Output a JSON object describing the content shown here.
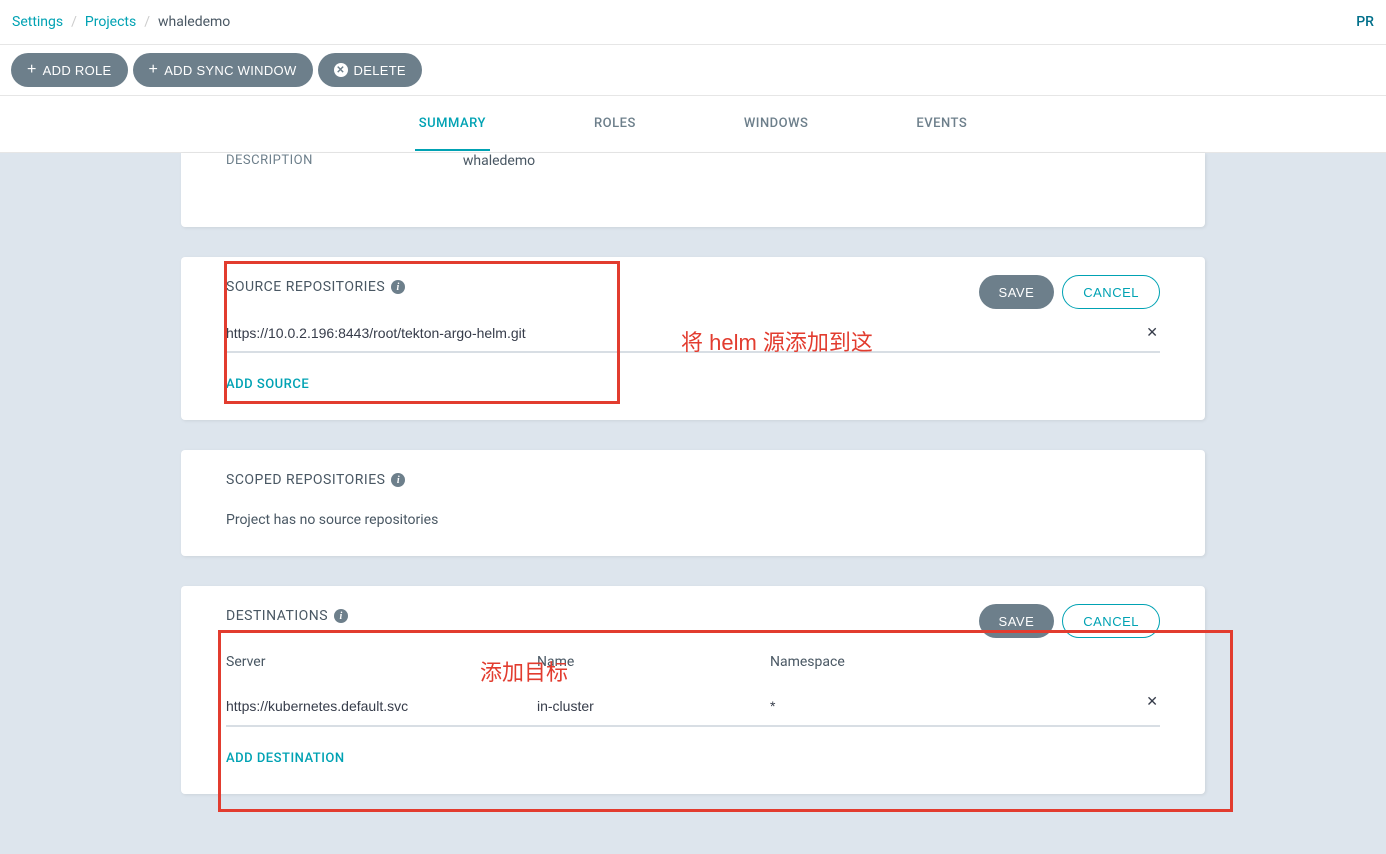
{
  "breadcrumb": {
    "settings": "Settings",
    "projects": "Projects",
    "current": "whaledemo"
  },
  "user_badge": "PR",
  "toolbar": {
    "add_role": "ADD ROLE",
    "add_sync_window": "ADD SYNC WINDOW",
    "delete": "DELETE"
  },
  "tabs": {
    "summary": "SUMMARY",
    "roles": "ROLES",
    "windows": "WINDOWS",
    "events": "EVENTS"
  },
  "description": {
    "label": "DESCRIPTION",
    "value": "whaledemo"
  },
  "source_repos": {
    "title": "SOURCE REPOSITORIES",
    "save": "SAVE",
    "cancel": "CANCEL",
    "items": [
      {
        "url": "https://10.0.2.196:8443/root/tekton-argo-helm.git"
      }
    ],
    "add_label": "ADD SOURCE"
  },
  "scoped_repos": {
    "title": "SCOPED REPOSITORIES",
    "empty": "Project has no source repositories"
  },
  "destinations": {
    "title": "DESTINATIONS",
    "save": "SAVE",
    "cancel": "CANCEL",
    "headers": {
      "server": "Server",
      "name": "Name",
      "namespace": "Namespace"
    },
    "rows": [
      {
        "server": "https://kubernetes.default.svc",
        "name": "in-cluster",
        "namespace": "*"
      }
    ],
    "add_label": "ADD DESTINATION"
  },
  "annotations": {
    "a1": "将 helm 源添加到这",
    "a2": "添加目标"
  }
}
